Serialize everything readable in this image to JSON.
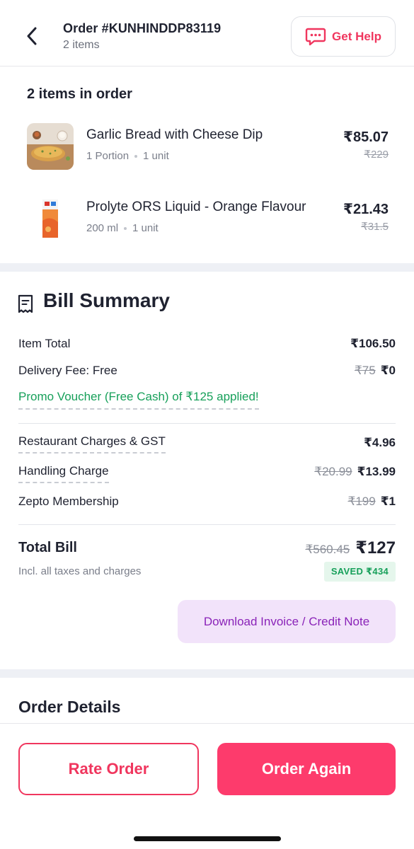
{
  "header": {
    "order_number": "Order #KUNHINDDP83119",
    "item_count": "2 items",
    "help_label": "Get Help"
  },
  "items_section": {
    "title": "2 items in order",
    "items": [
      {
        "name": "Garlic Bread with Cheese Dip",
        "qty": "1 Portion",
        "units": "1 unit",
        "price": "₹85.07",
        "mrp": "₹229"
      },
      {
        "name": "Prolyte ORS Liquid - Orange Flavour",
        "qty": "200 ml",
        "units": "1 unit",
        "price": "₹21.43",
        "mrp": "₹31.5"
      }
    ]
  },
  "bill": {
    "title": "Bill Summary",
    "item_total_label": "Item Total",
    "item_total_value": "₹106.50",
    "delivery_label": "Delivery Fee: Free",
    "delivery_strike": "₹75",
    "delivery_value": "₹0",
    "promo_text": "Promo Voucher (Free Cash) of ₹125 applied!",
    "restaurant_label": "Restaurant Charges & GST",
    "restaurant_value": "₹4.96",
    "handling_label": "Handling Charge",
    "handling_strike": "₹20.99",
    "handling_value": "₹13.99",
    "membership_label": "Zepto Membership",
    "membership_strike": "₹199",
    "membership_value": "₹1",
    "total_label": "Total Bill",
    "total_sub": "Incl. all taxes and charges",
    "total_strike": "₹560.45",
    "total_value": "₹127",
    "saved_badge": "SAVED ₹434",
    "invoice_button": "Download Invoice / Credit Note"
  },
  "order_details": {
    "title": "Order Details"
  },
  "actions": {
    "rate_label": "Rate Order",
    "again_label": "Order Again"
  },
  "colors": {
    "brand_pink": "#fd3b6c",
    "accent_red": "#f0365e",
    "promo_green": "#17a05a",
    "invoice_purple": "#8a23b8"
  },
  "icons": [
    "back-arrow-icon",
    "chat-help-icon",
    "receipt-icon"
  ]
}
